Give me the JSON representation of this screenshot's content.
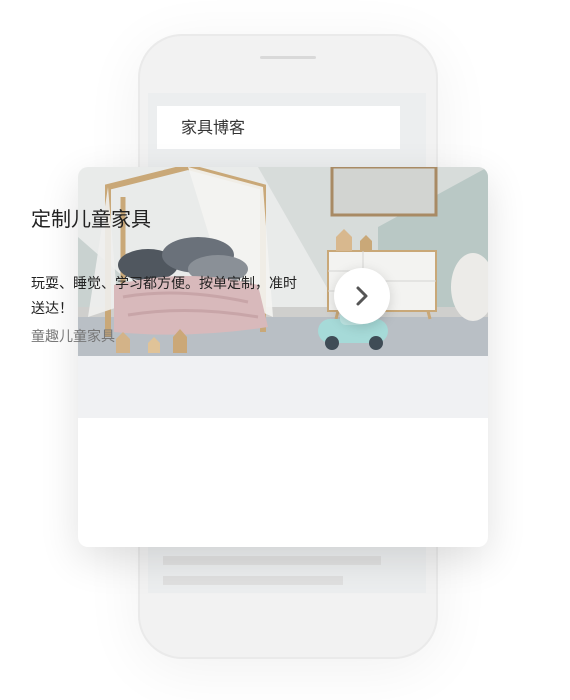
{
  "app": {
    "header_title": "家具博客"
  },
  "ad_card": {
    "title": "定制儿童家具",
    "description": "玩耍、睡觉、学习都方便。按单定制，准时送达！",
    "brand": "童趣儿童家具",
    "image_subject": "children-bedroom-photo",
    "next_icon": "chevron-right-icon"
  }
}
